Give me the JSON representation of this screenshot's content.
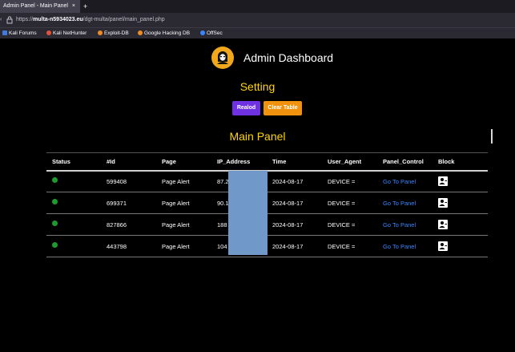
{
  "browser": {
    "tab_title": "Admin Panel - Main Panel",
    "tab_close": "×",
    "new_tab": "+",
    "url_prefix": "https://",
    "url_domain": "multa-n5934023.eu",
    "url_path": "/dgt-multa/panel/main_panel.php",
    "bookmarks": [
      {
        "label": "Kali Forums",
        "color": "#3f7bdc"
      },
      {
        "label": "Kali NetHunter",
        "color": "#e0533d"
      },
      {
        "label": "Exploit-DB",
        "color": "#f08a24"
      },
      {
        "label": "Google Hacking DB",
        "color": "#f08a24"
      },
      {
        "label": "OffSec",
        "color": "#3a86ff"
      }
    ]
  },
  "header": {
    "title": "Admin Dashboard",
    "avatar_icon": "hacker-mask-icon"
  },
  "setting": {
    "title": "Setting",
    "reload_label": "Realod",
    "clear_label": "Clear Table"
  },
  "main": {
    "title": "Main Panel",
    "columns": [
      "Status",
      "#Id",
      "Page",
      "IP_Address",
      "Time",
      "User_Agent",
      "Panel_Control",
      "Block"
    ],
    "rows": [
      {
        "id": "599408",
        "page": "Page Alert",
        "ip": "87.2",
        "time": "2024-08-17",
        "ua": "DEVICE =",
        "panel": "Go To Panel"
      },
      {
        "id": "699371",
        "page": "Page Alert",
        "ip": "90.1",
        "time": "2024-08-17",
        "ua": "DEVICE =",
        "panel": "Go To Panel"
      },
      {
        "id": "827866",
        "page": "Page Alert",
        "ip": "188",
        "time": "2024-08-17",
        "ua": "DEVICE =",
        "panel": "Go To Panel"
      },
      {
        "id": "443798",
        "page": "Page Alert",
        "ip": "104",
        "time": "2024-08-17",
        "ua": "DEVICE =",
        "panel": "Go To Panel"
      }
    ]
  },
  "colors": {
    "accent_yellow": "#ffd400",
    "reload_purple": "#6f32e3",
    "clear_orange": "#f0920e",
    "link_blue": "#3a86ff",
    "status_green": "#1f9a2e"
  }
}
